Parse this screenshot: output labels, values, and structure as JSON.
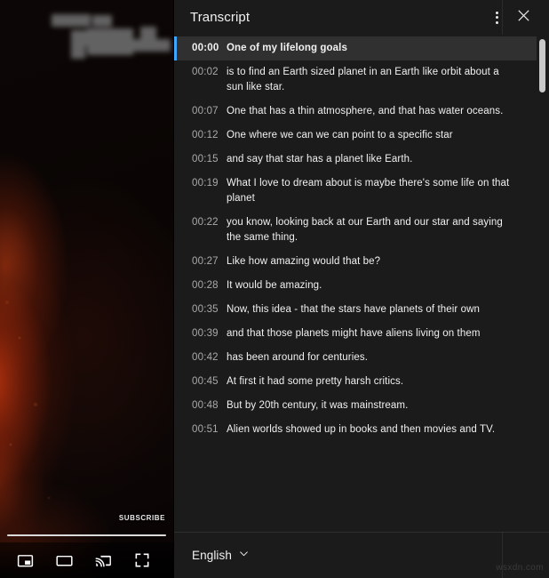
{
  "player": {
    "subscribe_label": "SUBSCRIBE",
    "progress_percent": 100,
    "controls": [
      {
        "name": "miniplayer-button",
        "icon": "miniplayer-icon",
        "label": "Miniplayer"
      },
      {
        "name": "theater-mode-button",
        "icon": "theater-mode-icon",
        "label": "Theater mode"
      },
      {
        "name": "cast-button",
        "icon": "cast-icon",
        "label": "Play on TV"
      },
      {
        "name": "fullscreen-button",
        "icon": "fullscreen-icon",
        "label": "Full screen"
      }
    ]
  },
  "transcript": {
    "title": "Transcript",
    "menu_icon": "more-vertical-icon",
    "close_icon": "close-icon",
    "language": "English",
    "language_chevron_icon": "chevron-down-icon",
    "active_index": 0,
    "entries": [
      {
        "time": "00:00",
        "text": "One of my lifelong goals"
      },
      {
        "time": "00:02",
        "text": "is to find an Earth sized planet in an Earth like orbit about a sun like star."
      },
      {
        "time": "00:07",
        "text": "One that has a thin atmosphere, and that has water oceans."
      },
      {
        "time": "00:12",
        "text": "One where we can we can point to a specific star"
      },
      {
        "time": "00:15",
        "text": "and say that star has a planet like Earth."
      },
      {
        "time": "00:19",
        "text": "What I love to dream about is maybe there's some life on that planet"
      },
      {
        "time": "00:22",
        "text": "you know, looking back at our Earth and our star and saying the same thing."
      },
      {
        "time": "00:27",
        "text": "Like how amazing would that be?"
      },
      {
        "time": "00:28",
        "text": "It would be amazing."
      },
      {
        "time": "00:35",
        "text": "Now, this idea - that the stars have planets of their own"
      },
      {
        "time": "00:39",
        "text": "and that those planets might have aliens living on them"
      },
      {
        "time": "00:42",
        "text": "has been around for centuries."
      },
      {
        "time": "00:45",
        "text": "At first it had some pretty harsh critics."
      },
      {
        "time": "00:48",
        "text": "But by 20th century, it was mainstream."
      },
      {
        "time": "00:51",
        "text": "Alien worlds showed up in books and then movies and TV."
      }
    ]
  },
  "watermark": {
    "text": "wsxdn.com"
  },
  "colors": {
    "accent": "#3ea6ff",
    "panel_bg": "#1b1b1b",
    "active_row_bg": "#303030",
    "text_primary": "#f1f1f1",
    "text_secondary": "#aaaaaa"
  }
}
